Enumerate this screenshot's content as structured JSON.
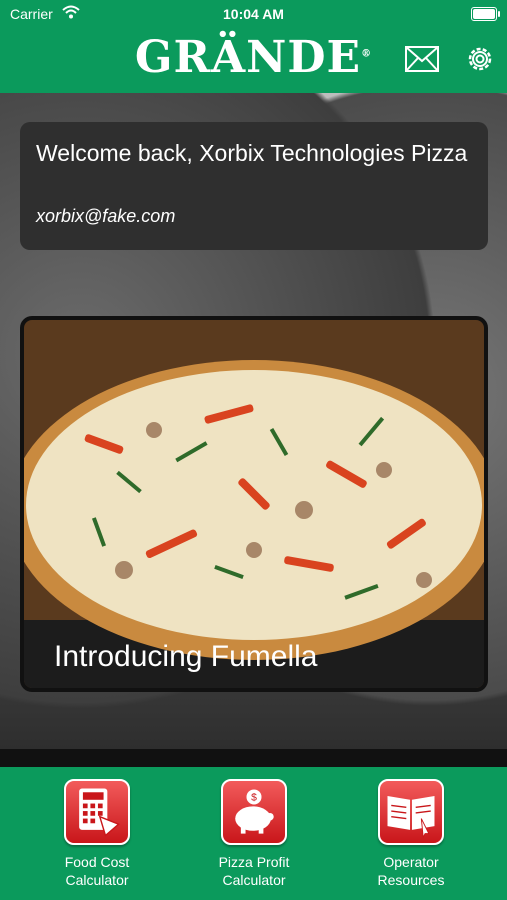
{
  "status_bar": {
    "carrier": "Carrier",
    "time": "10:04 AM"
  },
  "header": {
    "logo_text": "GRÄNDE",
    "logo_mark": "®",
    "mail_icon": "mail-icon",
    "settings_icon": "gear-icon"
  },
  "welcome": {
    "title": "Welcome back, Xorbix Technologies Pizza",
    "email": "xorbix@fake.com"
  },
  "promo": {
    "caption": "Introducing Fumella"
  },
  "bottom_nav": [
    {
      "line1": "Food Cost",
      "line2": "Calculator",
      "icon": "calculator-pizza-icon"
    },
    {
      "line1": "Pizza Profit",
      "line2": "Calculator",
      "icon": "piggy-bank-icon"
    },
    {
      "line1": "Operator",
      "line2": "Resources",
      "icon": "book-icon"
    }
  ],
  "colors": {
    "brand_green": "#0b9a5c",
    "icon_red": "#c9161a"
  }
}
